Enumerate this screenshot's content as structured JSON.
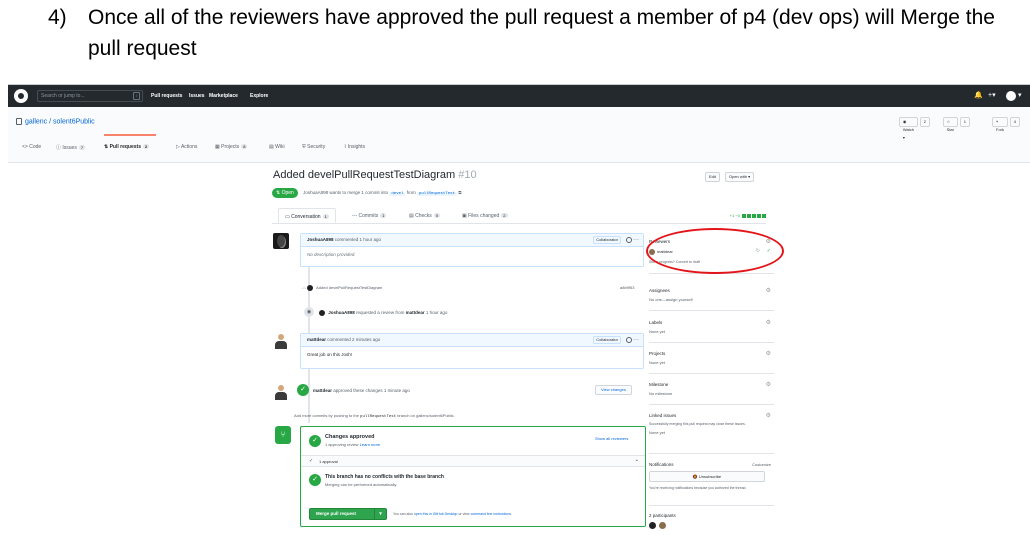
{
  "doc": {
    "step_number": "4)",
    "instruction": "Once all of the reviewers have approved the pull request a member of p4 (dev ops) will Merge the pull request"
  },
  "github": {
    "search_placeholder": "Search or jump to...",
    "search_key": "/",
    "nav": [
      "Pull requests",
      "Issues",
      "Marketplace",
      "Explore"
    ],
    "right_icons": [
      "🔔",
      "+▾",
      "▾"
    ]
  },
  "repo": {
    "owner_name": "gallenc / solent6Public",
    "watch_label": "◉ Watch ▾",
    "watch_count": "2",
    "star_label": "☆ Star",
    "star_count": "1",
    "fork_label": "Fork",
    "fork_count": "4",
    "tabs": [
      {
        "label": "<> Code",
        "count": ""
      },
      {
        "label": "ⓘ Issues",
        "count": "7"
      },
      {
        "label": "Pull requests",
        "count": "2"
      },
      {
        "label": "▷ Actions",
        "count": ""
      },
      {
        "label": "▦ Projects",
        "count": "8"
      },
      {
        "label": "▤ Wiki",
        "count": ""
      },
      {
        "label": "⛨ Security",
        "count": ""
      },
      {
        "label": "⌇ Insights",
        "count": ""
      }
    ]
  },
  "pr": {
    "title": "Added develPullRequestTestDiagram",
    "number": "#10",
    "status": "Open",
    "status_text": "JoshuaA898 wants to merge 1 commit into",
    "base_branch": "devel",
    "from_text": "from",
    "head_branch": "pullRequestTest",
    "edit_label": "Edit",
    "open_with_label": "Open with ▾",
    "tabs": [
      {
        "label": "Conversation",
        "count": "1"
      },
      {
        "label": "Commits",
        "count": "1"
      },
      {
        "label": "Checks",
        "count": "0"
      },
      {
        "label": "Files changed",
        "count": "2"
      }
    ],
    "diffstat": "+1 −0"
  },
  "timeline": {
    "comment1": {
      "author": "JoshuaA898",
      "meta": "commented 1 hour ago",
      "badge": "Collaborator",
      "body": "No description provided."
    },
    "commit": {
      "message": "Added develPullRequestTestDiagram",
      "sha": "a8b9f53"
    },
    "review_request": {
      "author": "JoshuaA898",
      "text": "requested a review from",
      "target": "mattdear",
      "time": "1 hour ago"
    },
    "comment2": {
      "author": "mattdear",
      "meta": "commented 2 minutes ago",
      "badge": "Collaborator",
      "body": "Great job on this Josh!"
    },
    "approval": {
      "author": "mattdear",
      "text": "approved these changes 1 minute ago",
      "button": "View changes"
    },
    "hint": "Add more commits by pushing to the",
    "hint_branch": "pullRequestTest",
    "hint_suffix": "branch on gallenc/solent6Public."
  },
  "merge": {
    "approved_title": "Changes approved",
    "approved_sub": "1 approving review",
    "learn_more": "Learn more",
    "show_all": "Show all reviewers",
    "approval_count": "1 approval",
    "conflict_title": "This branch has no conflicts with the base branch",
    "conflict_sub": "Merging can be performed automatically.",
    "button": "Merge pull request",
    "also_prefix": "You can also",
    "also_link1": "open this in GitHub Desktop",
    "also_mid": "or view",
    "also_link2": "command line instructions",
    "also_suffix": "."
  },
  "sidebar": {
    "reviewers_title": "Reviewers",
    "reviewer": "mattdear",
    "draft_text": "Still in progress? Convert to draft",
    "assignees_title": "Assignees",
    "assignees_value": "No one—assign yourself",
    "labels_title": "Labels",
    "labels_value": "None yet",
    "projects_title": "Projects",
    "projects_value": "None yet",
    "milestone_title": "Milestone",
    "milestone_value": "No milestone",
    "linked_title": "Linked issues",
    "linked_value": "Successfully merging this pull request may close these issues.",
    "linked_none": "None yet",
    "notifications_title": "Notifications",
    "customize": "Customize",
    "unsubscribe": "🔕 Unsubscribe",
    "notif_text": "You're receiving notifications because you authored the thread.",
    "participants": "2 participants"
  },
  "colors": {
    "annotation": "#e3141a",
    "open_green": "#28a745",
    "header_dark": "#24292e",
    "link_blue": "#0366d6"
  }
}
